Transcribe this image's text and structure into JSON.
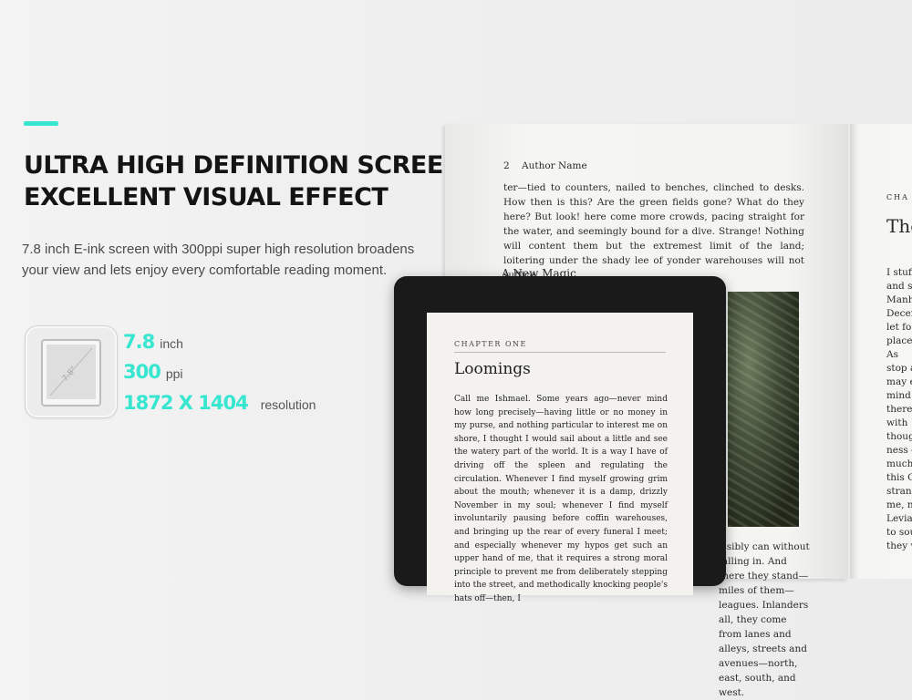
{
  "feature": {
    "headline_line1": "ULTRA HIGH DEFINITION SCREEN",
    "headline_line2": "EXCELLENT VISUAL EFFECT",
    "description": "7.8 inch E-ink screen with 300ppi super high resolution broadens your view and lets enjoy every comfortable reading moment.",
    "accent_color": "#37e6cf"
  },
  "specs": {
    "icon_label": "7.8\"",
    "items": [
      {
        "value": "7.8",
        "unit": "inch"
      },
      {
        "value": "300",
        "unit": "ppi"
      },
      {
        "value": "1872 X 1404",
        "unit": "resolution"
      }
    ]
  },
  "book": {
    "left_header": "2    Author Name",
    "left_paragraph": "ter—tied to counters, nailed to benches, clinched to desks. How then is this? Are the green fields gone? What do they here? But look! here come more crowds, pacing straight for the water, and seemingly bound for a dive. Strange! Nothing will content them but the extremest limit of the land; loitering under the shady lee of yonder warehouses will not suffice.",
    "left_subheading": "A New Magic",
    "left_bottom": "issibly can without falling in. And there they stand—miles of them—leagues. Inlanders all, they come from lanes and alleys, streets and avenues—north, east, south, and west.",
    "right_chapter": "CHA",
    "right_title": "The",
    "right_column": "I stuff\nand st\nManha\nDecer\nlet fo\nplace\nAs\nstop a\nmay e\nmind\nthere\nwith\nthoug\nness o\nmuch\nthis C\nstran\nme, n\nLeviat\nto sou\nthey v"
  },
  "reader": {
    "chapter_label": "CHAPTER ONE",
    "chapter_title": "Loomings",
    "body": "Call me Ishmael. Some years ago—never mind how long precisely—having little or no money in my purse, and nothing particular to interest me on shore, I thought I would sail about a little and see the watery part of the world. It is a way I have of driving off the spleen and regulating the circulation. Whenever I find myself growing grim about the mouth; whenever it is a damp, drizzly November in my soul; whenever I find myself involuntarily pausing before coffin warehouses, and bringing up the rear of every funeral I meet; and especially whenever my hypos get such an upper hand of me, that it requires a strong moral principle to prevent me from deliberately stepping into the street, and methodically knocking people's hats off—then, I"
  }
}
